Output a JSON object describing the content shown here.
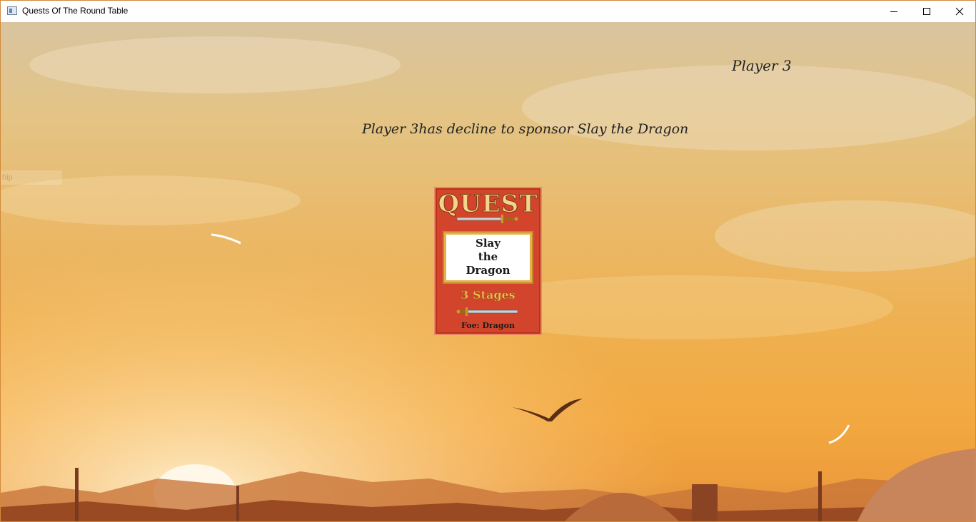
{
  "window": {
    "title": "Quests Of The Round Table",
    "controls": [
      "minimize-icon",
      "maximize-icon",
      "close-icon"
    ]
  },
  "game": {
    "current_player": "Player 3",
    "message": "Player 3has decline to sponsor Slay the Dragon",
    "faded_text": "hip"
  },
  "quest_card": {
    "heading": "QUEST",
    "name": "Slay\nthe\nDragon",
    "stages": "3 Stages",
    "foe": "Foe: Dragon"
  },
  "colors": {
    "card_red": "#d2452c",
    "card_gold": "#e5b24a",
    "sky_top": "#d9c49f",
    "sky_bottom": "#ee9d3c"
  }
}
